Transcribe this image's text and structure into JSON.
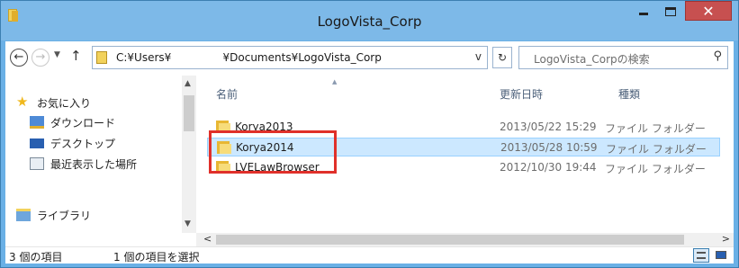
{
  "window": {
    "title": "LogoVista_Corp",
    "close_glyph": "✕",
    "colors": {
      "frame": "#7db9e8",
      "close": "#c75050",
      "selection": "#cce8ff",
      "highlight_box": "#e0302a"
    }
  },
  "nav": {
    "back_glyph": "←",
    "forward_glyph": "→",
    "dropdown_glyph": "▼",
    "up_glyph": "↑",
    "address_path": "C:¥Users¥               ¥Documents¥LogoVista_Corp",
    "address_dropdown_glyph": "v",
    "refresh_glyph": "↻",
    "search_placeholder": "LogoVista_Corpの検索",
    "search_icon": "search-icon"
  },
  "sidebar": {
    "items": [
      {
        "label": "お気に入り",
        "icon": "star-icon"
      },
      {
        "label": "ダウンロード",
        "icon": "downloads-icon"
      },
      {
        "label": "デスクトップ",
        "icon": "desktop-icon"
      },
      {
        "label": "最近表示した場所",
        "icon": "recent-places-icon"
      },
      {
        "label": "ライブラリ",
        "icon": "libraries-icon"
      }
    ]
  },
  "files": {
    "columns": {
      "name": "名前",
      "date": "更新日時",
      "type": "種類"
    },
    "rows": [
      {
        "name": "Korya2013",
        "date": "2013/05/22 15:29",
        "type": "ファイル フォルダー",
        "selected": false
      },
      {
        "name": "Korya2014",
        "date": "2013/05/28 10:59",
        "type": "ファイル フォルダー",
        "selected": true
      },
      {
        "name": "LVELawBrowser",
        "date": "2012/10/30 19:44",
        "type": "ファイル フォルダー",
        "selected": false
      }
    ]
  },
  "status": {
    "item_count": "3 個の項目",
    "selected_count": "1 個の項目を選択"
  }
}
